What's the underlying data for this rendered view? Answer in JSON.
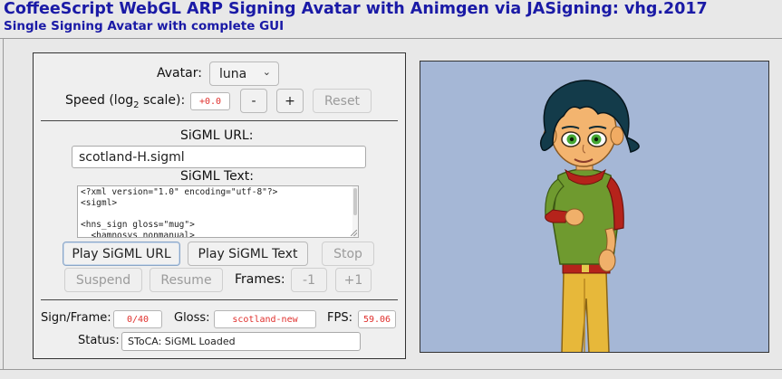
{
  "header": {
    "title": "CoffeeScript WebGL ARP Signing Avatar with Animgen via JASigning: vhg.2017",
    "subtitle": "Single Signing Avatar with complete GUI"
  },
  "controls": {
    "avatar_label": "Avatar:",
    "avatar_value": "luna",
    "speed_label_pre": "Speed (log",
    "speed_label_sub": "2",
    "speed_label_post": " scale):",
    "speed_value": "+0.0",
    "speed_minus": "-",
    "speed_plus": "+",
    "reset": "Reset",
    "sigml_url_label": "SiGML URL:",
    "sigml_url_value": "scotland-H.sigml",
    "sigml_text_label": "SiGML Text:",
    "sigml_text_value": "<?xml version=\"1.0\" encoding=\"utf-8\"?>\n<sigml>\n\n<hns_sign gloss=\"mug\">\n  <hamnosys_nonmanual>",
    "play_url": "Play SiGML URL",
    "play_text": "Play SiGML Text",
    "stop": "Stop",
    "suspend": "Suspend",
    "resume": "Resume",
    "frames_label": "Frames:",
    "frames_minus": "-1",
    "frames_plus": "+1"
  },
  "status": {
    "sign_frame_label": "Sign/Frame:",
    "sign_frame_value": "0/40",
    "gloss_label": "Gloss:",
    "gloss_value": "scotland-new",
    "fps_label": "FPS:",
    "fps_value": "59.06",
    "status_label": "Status:",
    "status_value": "SToCA: SiGML Loaded"
  },
  "colors": {
    "title": "#1a1aa6",
    "readout_text": "#e0302d",
    "viewport_bg": "#a5b7d6"
  }
}
